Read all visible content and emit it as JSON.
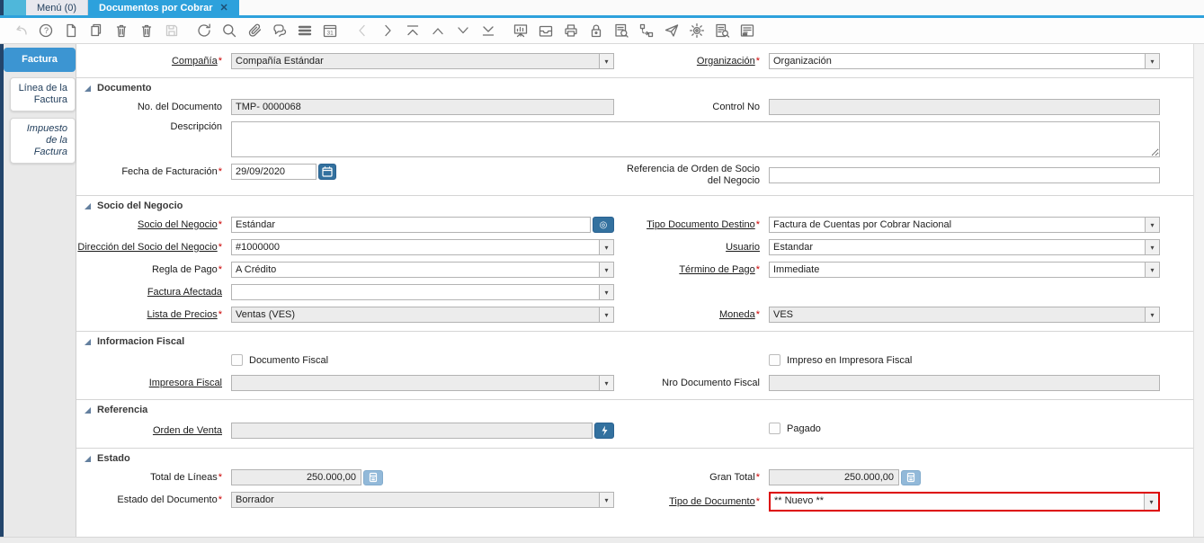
{
  "titlebar": {
    "tabs": [
      {
        "label": "Menú (0)"
      },
      {
        "label": "Documentos por Cobrar",
        "close_glyph": "✕"
      }
    ]
  },
  "toolbar": {
    "icons": [
      "undo",
      "help",
      "new-record",
      "copy-record",
      "delete-record",
      "delete-selection",
      "save",
      "refresh",
      "find",
      "attachment",
      "chat",
      "grid-toggle",
      "calendar",
      "previous-record",
      "next-record",
      "parent-record",
      "previous",
      "next-down",
      "detail-record",
      "report",
      "archive",
      "print",
      "lock",
      "record-info",
      "workflow",
      "request",
      "settings",
      "find-report",
      "print-preview"
    ]
  },
  "sidebar": {
    "tabs": [
      {
        "label": "Factura"
      },
      {
        "label": "Línea de la Factura"
      },
      {
        "label": "Impuesto de la Factura"
      }
    ]
  },
  "ui": {
    "glyphs": {
      "dropdown": "▾",
      "bp_info": "◎"
    },
    "colors": {
      "accent_blue": "#2da1dc",
      "sidebar_active": "#3c95d2",
      "button_blue": "#33719f",
      "calc_blue": "#92b9d9",
      "highlight_red": "#dd0000",
      "navy_strip": "#23456b"
    }
  },
  "form": {
    "sections": {
      "documento": "Documento",
      "socio": "Socio del Negocio",
      "fiscal": "Informacion Fiscal",
      "referencia": "Referencia",
      "estado": "Estado"
    },
    "fields": {
      "compania": {
        "label": "Compañía",
        "required": "*",
        "value": "Compañía Estándar"
      },
      "organizacion": {
        "label": "Organización",
        "required": "*",
        "value": "Organización"
      },
      "no_documento": {
        "label": "No. del Documento",
        "value": "TMP- 0000068"
      },
      "control_no": {
        "label": "Control No",
        "value": ""
      },
      "descripcion": {
        "label": "Descripción",
        "value": ""
      },
      "fecha_facturacion": {
        "label": "Fecha de Facturación",
        "required": "*",
        "value": "29/09/2020"
      },
      "referencia_orden": {
        "label": "Referencia de Orden de Socio del Negocio",
        "value": ""
      },
      "socio_negocio": {
        "label": "Socio del Negocio",
        "required": "*",
        "value": "Estándar"
      },
      "tipo_doc_destino": {
        "label": "Tipo Documento Destino",
        "required": "*",
        "value": "Factura de Cuentas por Cobrar Nacional"
      },
      "direccion_socio": {
        "label": "Dirección del Socio del Negocio",
        "required": "*",
        "value": "#1000000"
      },
      "usuario": {
        "label": "Usuario",
        "value": "Estandar"
      },
      "regla_pago": {
        "label": "Regla de Pago",
        "required": "*",
        "value": "A Crédito"
      },
      "termino_pago": {
        "label": "Término de Pago",
        "required": "*",
        "value": "Immediate"
      },
      "factura_afectada": {
        "label": "Factura Afectada",
        "value": ""
      },
      "lista_precios": {
        "label": "Lista de Precios",
        "required": "*",
        "value": "Ventas (VES)"
      },
      "moneda": {
        "label": "Moneda",
        "required": "*",
        "value": "VES"
      },
      "documento_fiscal": {
        "label": "Documento Fiscal",
        "checked": false
      },
      "impreso_fiscal": {
        "label": "Impreso en Impresora Fiscal",
        "checked": false
      },
      "impresora_fiscal": {
        "label": "Impresora Fiscal",
        "value": ""
      },
      "nro_doc_fiscal": {
        "label": "Nro Documento Fiscal",
        "value": ""
      },
      "orden_venta": {
        "label": "Orden de Venta",
        "value": ""
      },
      "pagado": {
        "label": "Pagado",
        "checked": false
      },
      "total_lineas": {
        "label": "Total de Líneas",
        "required": "*",
        "value": "250.000,00"
      },
      "gran_total": {
        "label": "Gran Total",
        "required": "*",
        "value": "250.000,00"
      },
      "estado_documento": {
        "label": "Estado del Documento",
        "required": "*",
        "value": "Borrador"
      },
      "tipo_documento": {
        "label": "Tipo de Documento",
        "required": "*",
        "value": "** Nuevo **"
      }
    }
  }
}
